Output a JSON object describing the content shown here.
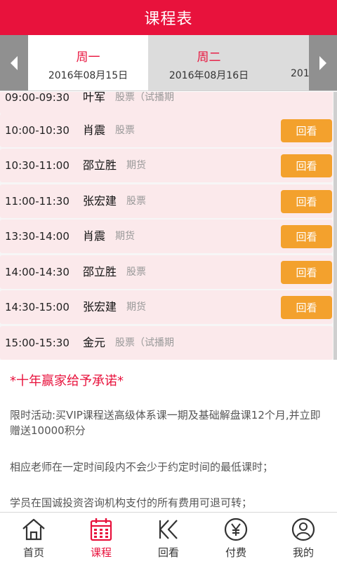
{
  "header": {
    "title": "课程表"
  },
  "days": [
    {
      "name": "周一",
      "date": "2016年08月15日"
    },
    {
      "name": "周二",
      "date": "2016年08月16日"
    },
    {
      "name": "",
      "date": "201"
    }
  ],
  "schedule": [
    {
      "time": "09:00-09:30",
      "teacher": "叶军",
      "subject": "股票（试播期"
    },
    {
      "time": "10:00-10:30",
      "teacher": "肖震",
      "subject": "股票",
      "action": "回看"
    },
    {
      "time": "10:30-11:00",
      "teacher": "邵立胜",
      "subject": "期货",
      "action": "回看"
    },
    {
      "time": "11:00-11:30",
      "teacher": "张宏建",
      "subject": "股票",
      "action": "回看"
    },
    {
      "time": "13:30-14:00",
      "teacher": "肖震",
      "subject": "期货",
      "action": "回看"
    },
    {
      "time": "14:00-14:30",
      "teacher": "邵立胜",
      "subject": "股票",
      "action": "回看"
    },
    {
      "time": "14:30-15:00",
      "teacher": "张宏建",
      "subject": "期货",
      "action": "回看"
    },
    {
      "time": "15:00-15:30",
      "teacher": "金元",
      "subject": "股票（试播期"
    }
  ],
  "promo": {
    "title": "*十年赢家给予承诺*",
    "p1": "限时活动:买VIP课程送高级体系课一期及基础解盘课12个月,并立即赠送10000积分",
    "p2": "相应老师在一定时间段内不会少于约定时间的最低课时；",
    "p3": "学员在国诚投资咨询机构支付的所有费用可退可转；"
  },
  "tabs": [
    {
      "label": "首页",
      "icon": "home-icon"
    },
    {
      "label": "课程",
      "icon": "calendar-icon"
    },
    {
      "label": "回看",
      "icon": "rewind-icon"
    },
    {
      "label": "付费",
      "icon": "yen-icon"
    },
    {
      "label": "我的",
      "icon": "user-icon"
    }
  ],
  "colors": {
    "accent": "#e8123c",
    "button": "#f3a12d",
    "row_bg": "#fbe9eb"
  }
}
